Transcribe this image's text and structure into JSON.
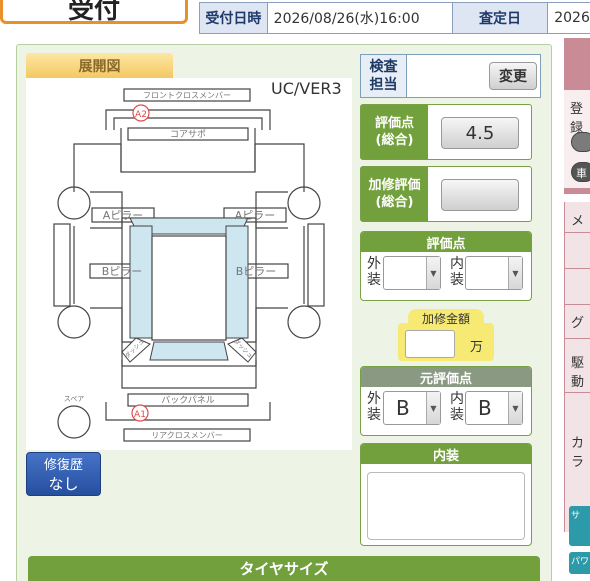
{
  "header": {
    "reception_tab": "受付",
    "received_at_label": "受付日時",
    "received_at_value": "2026/08/26(水)16:00",
    "inspection_date_label": "査定日",
    "inspection_date_value": "2026/"
  },
  "diagram": {
    "tab_label": "展開図",
    "version": "UC/VER3",
    "part_labels": {
      "front_cross_member": "フロントクロスメンバー",
      "core_support": "コアサポ",
      "a_pillar_left": "Aピラー",
      "a_pillar_right": "Aピラー",
      "b_pillar_left": "Bピラー",
      "b_pillar_right": "Bピラー",
      "back_panel": "バックパネル",
      "rear_cross_member": "リアクロスメンバー",
      "spare": "スペア",
      "dash_left": "ダッシュ",
      "dash_right": "ダッシュ"
    },
    "damage_markers": [
      "A2",
      "A1"
    ]
  },
  "repair_history": {
    "label": "修復歴",
    "value": "なし"
  },
  "inspector": {
    "label_line1": "検査",
    "label_line2": "担当",
    "change_button": "変更"
  },
  "overall_score": {
    "label_line1": "評価点",
    "label_line2": "(総合)",
    "value": "4.5"
  },
  "repair_score": {
    "label_line1": "加修評価",
    "label_line2": "(総合)",
    "value": ""
  },
  "score": {
    "header": "評価点",
    "exterior_1": "外",
    "exterior_2": "装",
    "interior_1": "内",
    "interior_2": "装",
    "exterior_value": "",
    "interior_value": ""
  },
  "repair_amount": {
    "label": "加修金額",
    "unit": "万",
    "value": ""
  },
  "original_score": {
    "header": "元評価点",
    "exterior_1": "外",
    "exterior_2": "装",
    "interior_1": "内",
    "interior_2": "装",
    "exterior_value": "B",
    "interior_value": "B"
  },
  "interior_notes": {
    "header": "内装",
    "value": ""
  },
  "tire_size": {
    "header": "タイヤサイズ"
  },
  "right_panel": {
    "label_1": "登録",
    "label_2": "車",
    "label_3": "メ",
    "label_4": "グ",
    "label_5": "駆動",
    "label_6": "カラ",
    "button_1": "サ",
    "button_2": "パワ"
  },
  "colors": {
    "accent_green": "#72a03c",
    "panel_bg": "#edf4e6",
    "window_blue": "#cde6f0",
    "marker_red": "#e04a4a",
    "reception_orange": "#e8902a"
  }
}
